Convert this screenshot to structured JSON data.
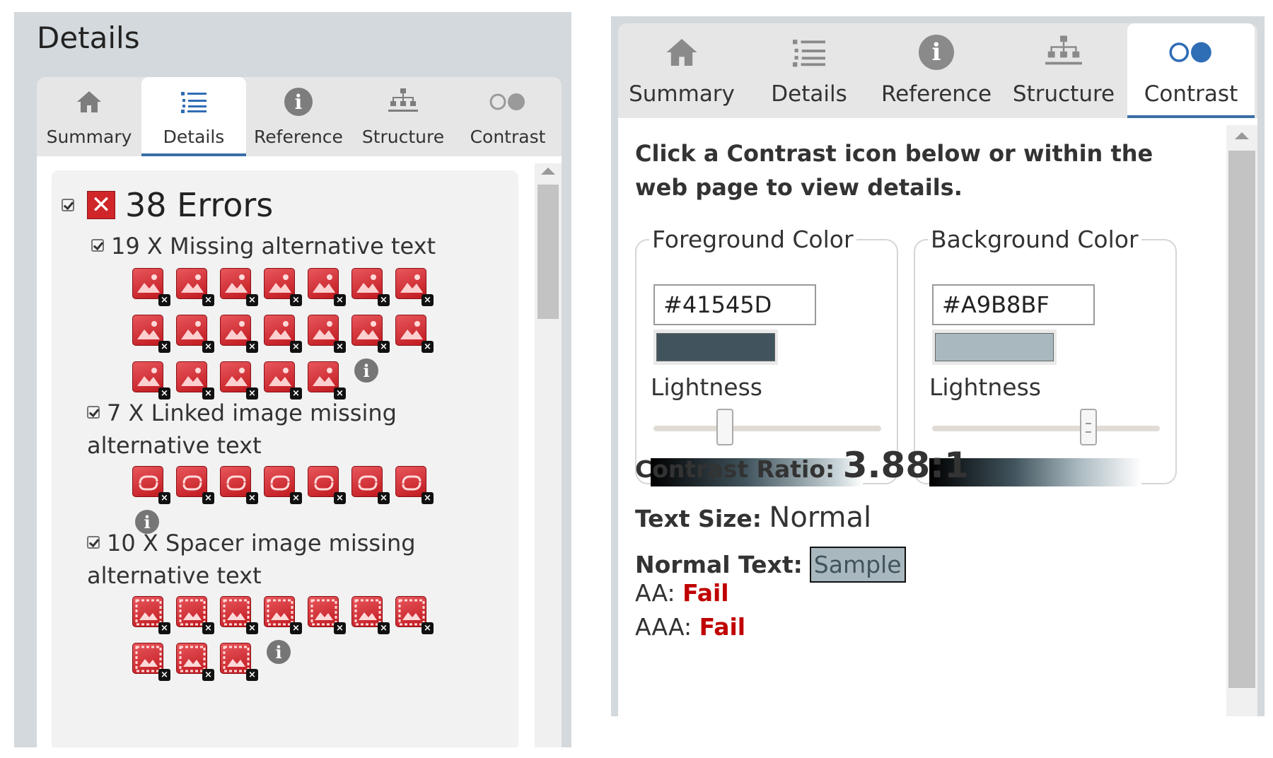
{
  "left": {
    "title": "Details",
    "tabs": [
      {
        "label": "Summary",
        "icon": "home-icon"
      },
      {
        "label": "Details",
        "icon": "list-icon"
      },
      {
        "label": "Reference",
        "icon": "info-icon"
      },
      {
        "label": "Structure",
        "icon": "structure-icon"
      },
      {
        "label": "Contrast",
        "icon": "contrast-icon"
      }
    ],
    "active_tab": "Details",
    "errors_title": "38 Errors",
    "groups": [
      {
        "title": "19 X Missing alternative text",
        "icon_type": "missing-alt-image-icon",
        "count": 19
      },
      {
        "title": "7 X Linked image missing alternative text",
        "icon_type": "linked-image-missing-alt-icon",
        "count": 7
      },
      {
        "title": "10 X Spacer image missing alternative text",
        "icon_type": "spacer-image-missing-alt-icon",
        "count": 10
      }
    ]
  },
  "right": {
    "tabs": [
      {
        "label": "Summary",
        "icon": "home-icon"
      },
      {
        "label": "Details",
        "icon": "list-icon"
      },
      {
        "label": "Reference",
        "icon": "info-icon"
      },
      {
        "label": "Structure",
        "icon": "structure-icon"
      },
      {
        "label": "Contrast",
        "icon": "contrast-icon"
      }
    ],
    "active_tab": "Contrast",
    "instruction": "Click a Contrast icon below or within the web page to view details.",
    "foreground": {
      "legend": "Foreground Color",
      "hex": "#41545D",
      "lightness_label": "Lightness",
      "lightness_value": 0.3
    },
    "background": {
      "legend": "Background Color",
      "hex": "#A9B8BF",
      "lightness_label": "Lightness",
      "lightness_value": 0.7
    },
    "contrast_ratio_label": "Contrast Ratio:",
    "contrast_ratio": "3.88:1",
    "text_size_label": "Text Size:",
    "text_size": "Normal",
    "normal_text_label": "Normal Text:",
    "sample_text": "Sample",
    "aa_label": "AA:",
    "aa_result": "Fail",
    "aaa_label": "AAA:",
    "aaa_result": "Fail"
  },
  "colors": {
    "error_red": "#d0262a",
    "fail_red": "#c00000",
    "active_tab_underline": "#3a6ea5",
    "panel_bg": "#d3d9dc"
  }
}
